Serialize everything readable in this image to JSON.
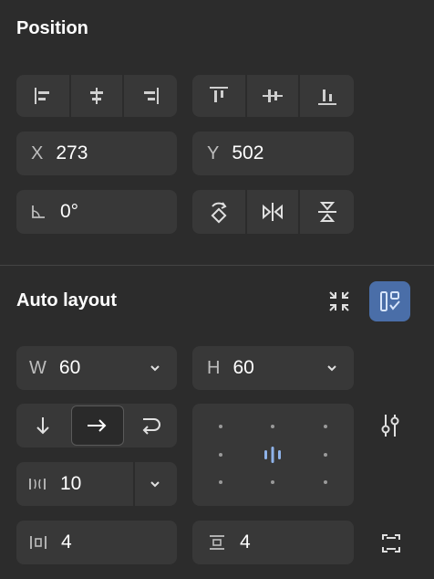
{
  "position": {
    "title": "Position",
    "x_label": "X",
    "x_value": "273",
    "y_label": "Y",
    "y_value": "502",
    "rotation_value": "0°",
    "align_icons": [
      "align-left-icon",
      "align-horizontal-center-icon",
      "align-right-icon"
    ],
    "valign_icons": [
      "align-top-icon",
      "align-vertical-center-icon",
      "align-bottom-icon"
    ],
    "transform_icons": [
      "rotate-90-icon",
      "flip-horizontal-icon",
      "flip-vertical-icon"
    ]
  },
  "auto_layout": {
    "title": "Auto layout",
    "w_label": "W",
    "w_value": "60",
    "h_label": "H",
    "h_value": "60",
    "direction_options": [
      "vertical",
      "horizontal",
      "wrap"
    ],
    "direction_selected": "horizontal",
    "gap_value": "10",
    "padding_horizontal_value": "4",
    "padding_vertical_value": "4"
  },
  "colors": {
    "panel_bg": "#2c2c2c",
    "field_bg": "#383838",
    "accent": "#4a6ea8",
    "accent_icon": "#8fb3ea"
  }
}
